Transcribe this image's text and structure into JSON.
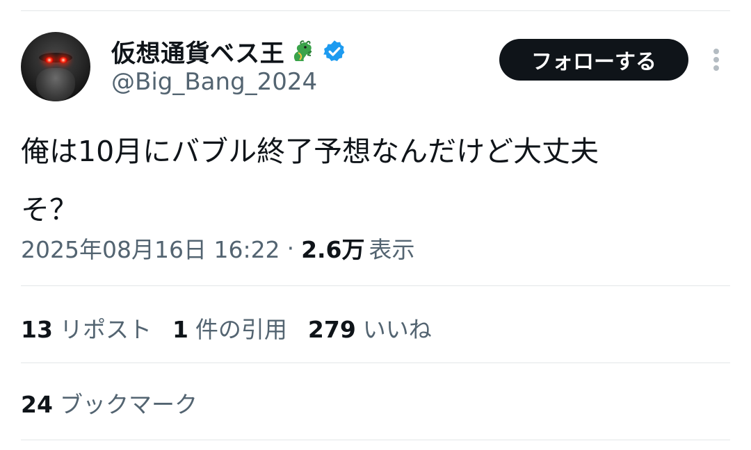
{
  "user": {
    "display_name": "仮想通貨ベス王",
    "name_emoji": "dragon-emoji",
    "verified": true,
    "handle": "@Big_Bang_2024"
  },
  "follow_button": {
    "label": "フォローする"
  },
  "tweet": {
    "text": "俺は10月にバブル終了予想なんだけど大丈夫\nそ？",
    "timestamp": "2025年08月16日 16:22",
    "separator": "·",
    "views_count": "2.6万",
    "views_label": "表示"
  },
  "stats": [
    {
      "count": "13",
      "label": "リポスト"
    },
    {
      "count": "1",
      "label": "件の引用"
    },
    {
      "count": "279",
      "label": "いいね"
    }
  ],
  "bookmarks": {
    "count": "24",
    "label": "ブックマーク"
  },
  "colors": {
    "text_primary": "#0f1419",
    "text_secondary": "#536471",
    "verified_blue": "#1d9bf0",
    "divider": "#e3e6e8",
    "button_bg": "#0f1419"
  }
}
